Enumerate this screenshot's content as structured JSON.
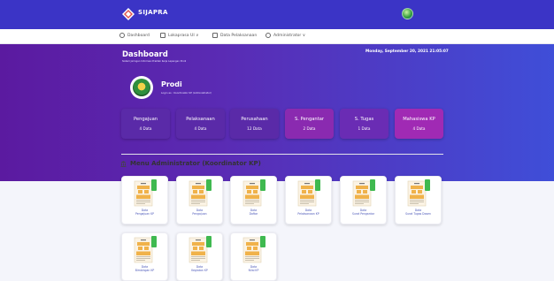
{
  "app": {
    "brand": "SIJAPRA"
  },
  "nav": {
    "items": [
      {
        "label": "Dashboard"
      },
      {
        "label": "Lokaprasa UI ∨"
      },
      {
        "label": "Data Pelaksanaan"
      },
      {
        "label": "Administrator ∨"
      }
    ]
  },
  "header": {
    "title": "Dashboard",
    "subtitle": "Sistem Jaringan Informasi Praktek Kerja Lapangan Prodi",
    "datetime": "Monday, September 20, 2021 21:05:07"
  },
  "profile": {
    "name": "Prodi",
    "role": "Login as : Koordinator KP (Administrator)"
  },
  "stats": [
    {
      "label": "Pengajuan",
      "value": "4 Data",
      "color": "#5a2aa8"
    },
    {
      "label": "Pelaksanaan",
      "value": "4 Data",
      "color": "#5a2aa8"
    },
    {
      "label": "Perusahaan",
      "value": "12 Data",
      "color": "#5a2aa8"
    },
    {
      "label": "S. Pengantar",
      "value": "2 Data",
      "color": "#8a2ab0"
    },
    {
      "label": "S. Tugas",
      "value": "1 Data",
      "color": "#6a2cb4"
    },
    {
      "label": "Mahasiswa KP",
      "value": "4 Data",
      "color": "#a02ab4"
    }
  ],
  "section": {
    "title": "Menu Administrator (Koordinator KP)"
  },
  "menu": [
    {
      "label1": "Data",
      "label2": "Pengajuan KP"
    },
    {
      "label1": "Data",
      "label2": "Pengajuan"
    },
    {
      "label1": "Data",
      "label2": "Daftar"
    },
    {
      "label1": "Data",
      "label2": "Pelaksanaan KP"
    },
    {
      "label1": "Data",
      "label2": "Surat Pengantar"
    },
    {
      "label1": "Data",
      "label2": "Surat Tugas Dosen"
    },
    {
      "label1": "Data",
      "label2": "Bimbingan KP"
    },
    {
      "label1": "Data",
      "label2": "Kegiatan KP"
    },
    {
      "label1": "Data",
      "label2": "Nilai KP"
    }
  ],
  "colors": {
    "topbar": "#3b34c6",
    "accent": "#4a56b8",
    "thumb_tab": "#3fb950"
  }
}
